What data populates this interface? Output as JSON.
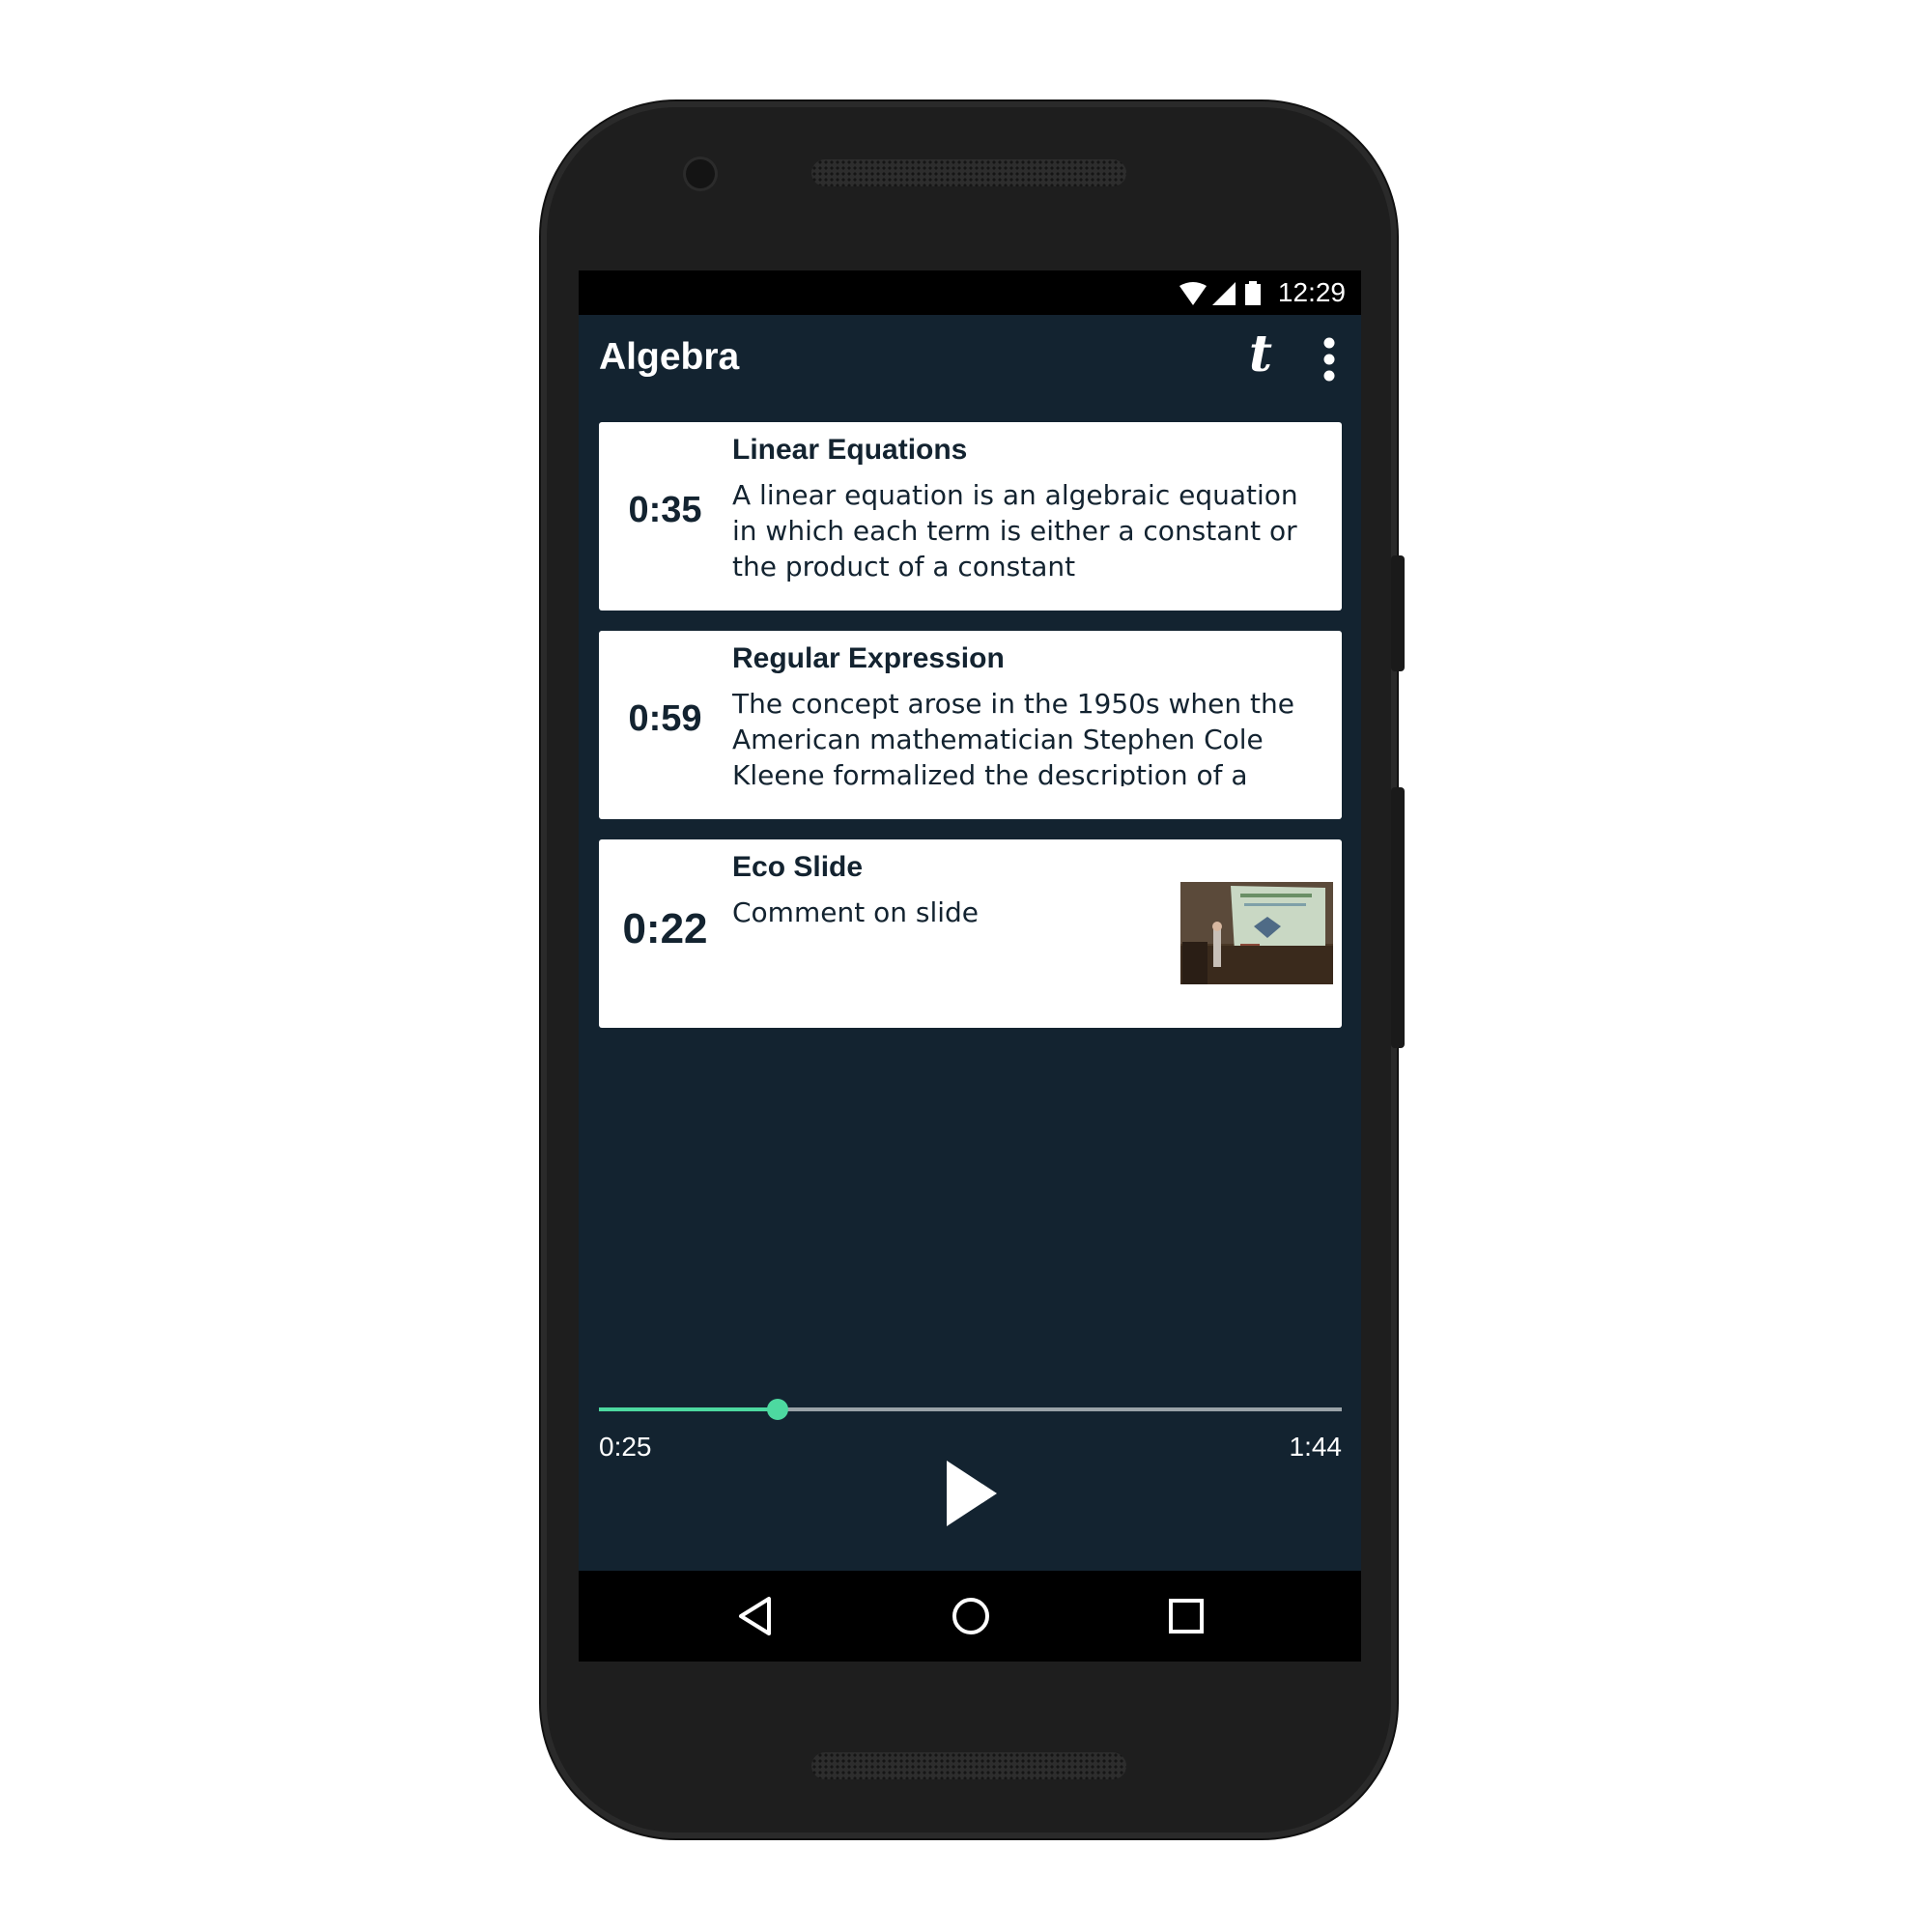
{
  "status_bar": {
    "time": "12:29"
  },
  "app_bar": {
    "title": "Algebra",
    "t_icon_label": "t"
  },
  "cards": [
    {
      "time": "0:35",
      "title": "Linear Equations",
      "body": "A linear equation is an algebraic equation in which each term is either a constant or the product of a constant"
    },
    {
      "time": "0:59",
      "title": "Regular Expression",
      "body": "The concept arose in the 1950s when the American mathematician Stephen Cole Kleene formalized the description of a regular language"
    },
    {
      "time": "0:22",
      "title": "Eco Slide",
      "body": "Comment on slide"
    }
  ],
  "player": {
    "current_time": "0:25",
    "total_time": "1:44",
    "progress_fraction": 0.24
  },
  "colors": {
    "background": "#132330",
    "accent": "#4dd9a0",
    "card": "#ffffff"
  },
  "icons": [
    "wifi-icon",
    "signal-icon",
    "battery-icon",
    "t-icon",
    "more-vert-icon",
    "play-icon",
    "back-icon",
    "home-icon",
    "recents-icon"
  ]
}
